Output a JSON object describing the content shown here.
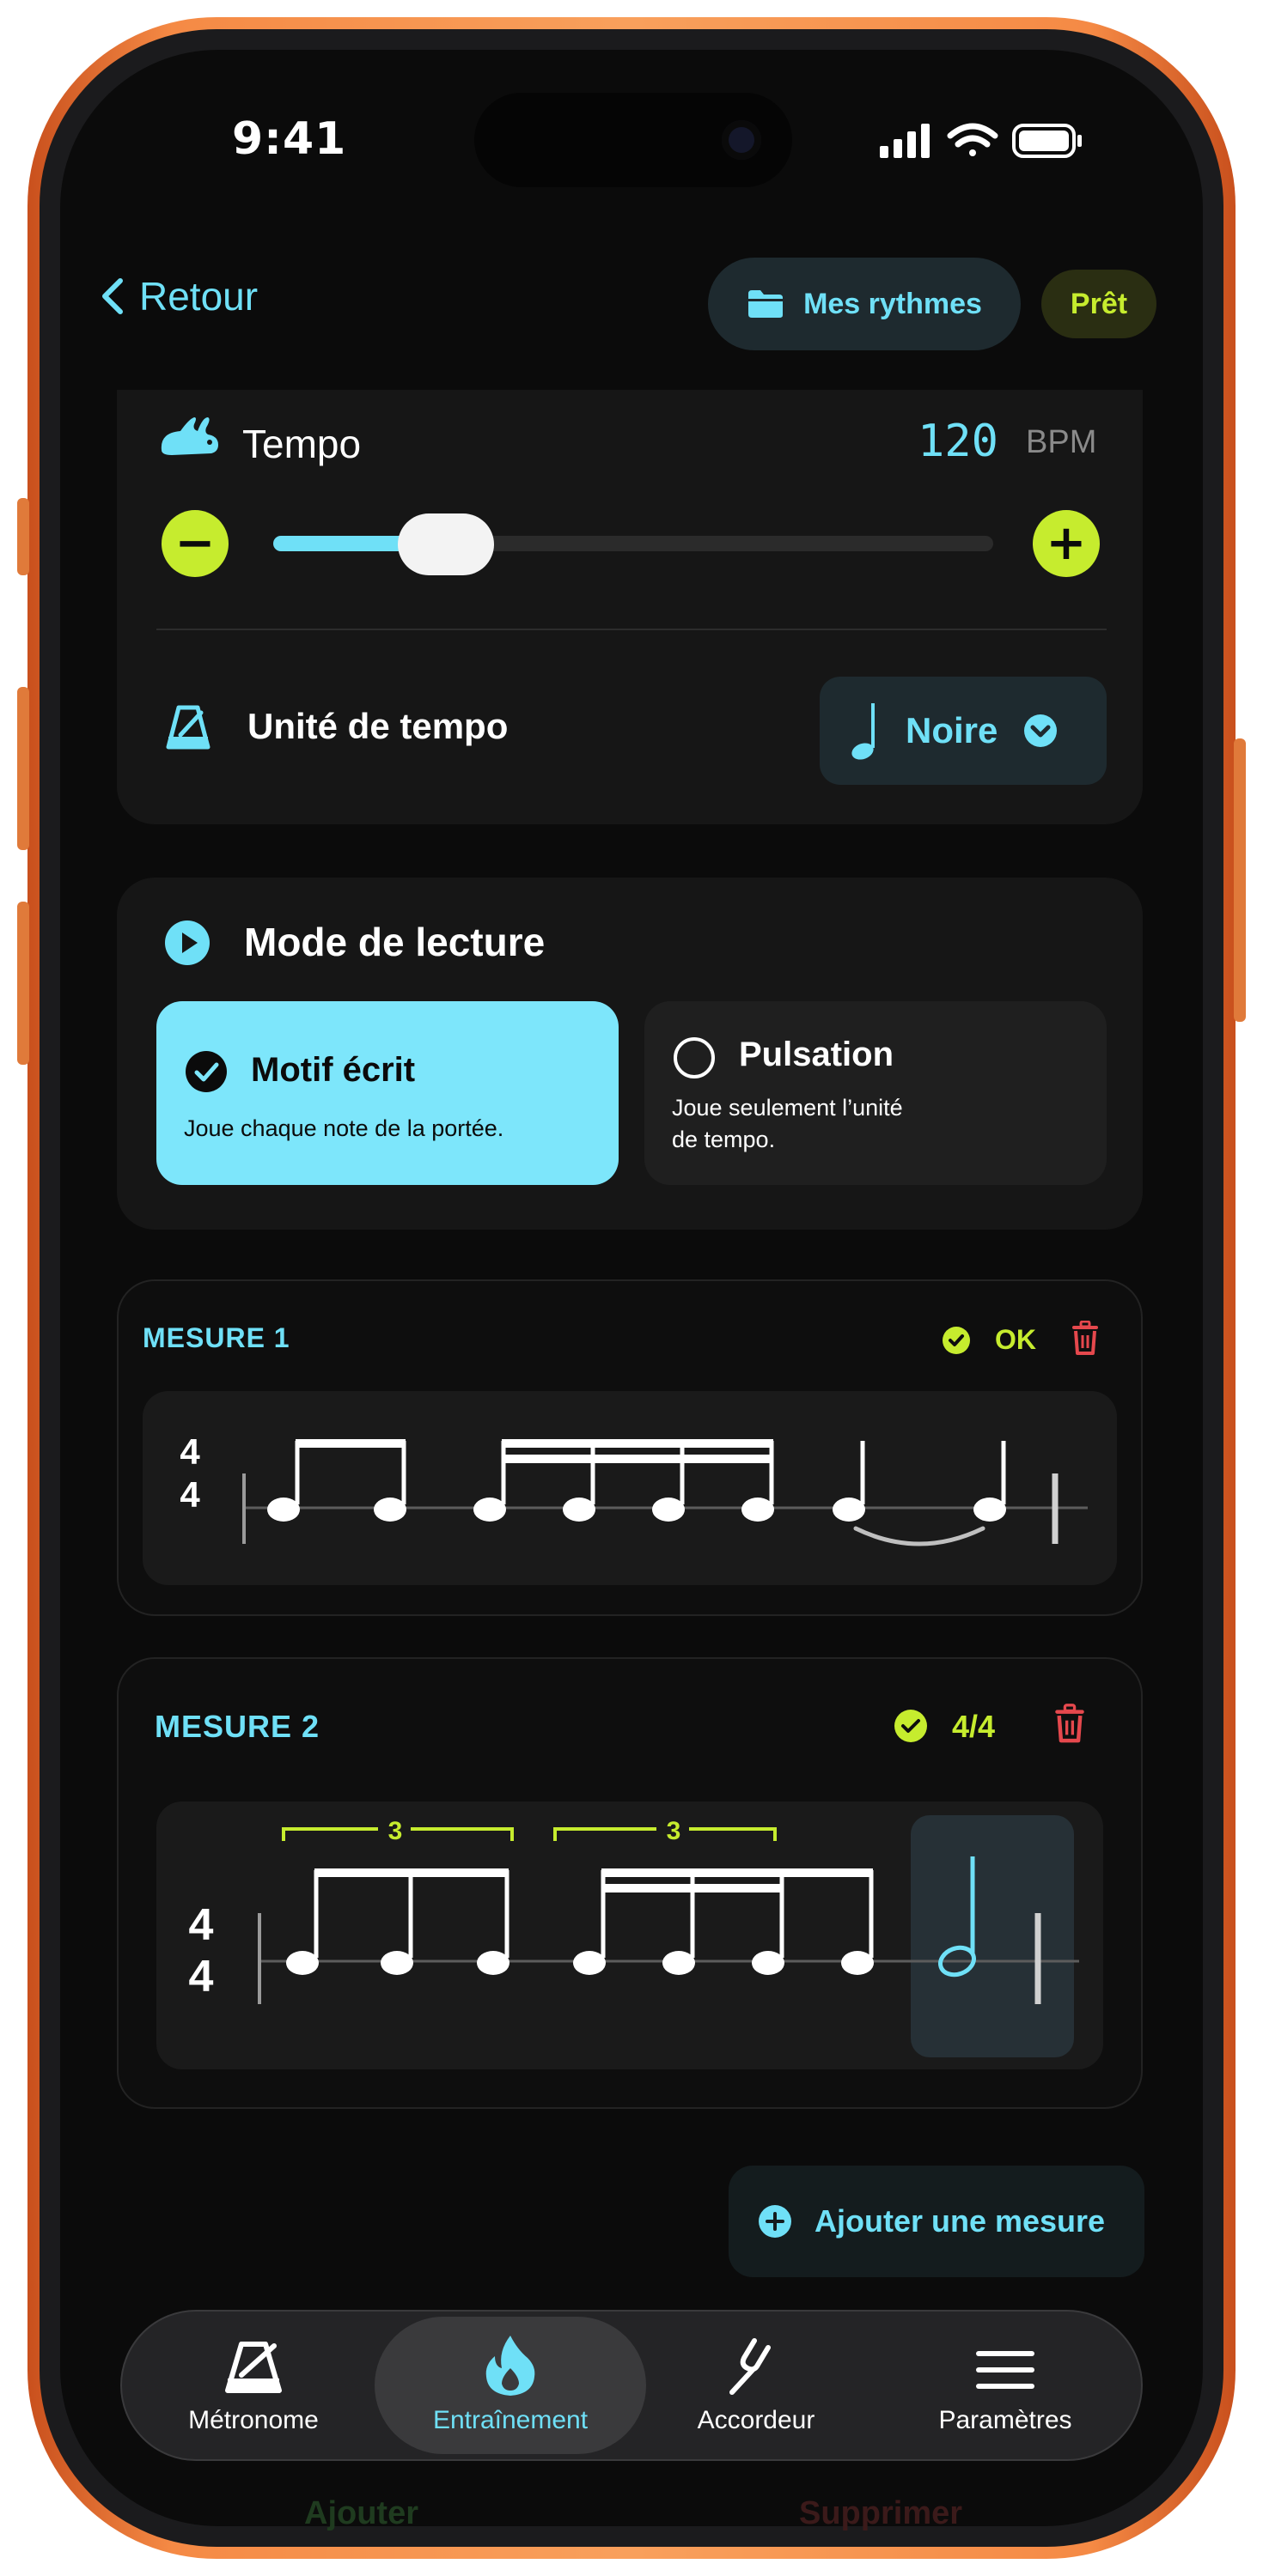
{
  "status_bar": {
    "time": "9:41"
  },
  "nav": {
    "back_label": "Retour",
    "rhythms_label": "Mes rythmes",
    "ready_badge": "Prêt"
  },
  "tempo": {
    "label": "Tempo",
    "value": "120",
    "unit": "BPM",
    "slider_fraction": 0.24,
    "minus": "−",
    "plus": "+"
  },
  "tempo_unit": {
    "label": "Unité de tempo",
    "selected": "Noire"
  },
  "play_mode": {
    "title": "Mode de lecture",
    "options": [
      {
        "title": "Motif écrit",
        "desc1": "Joue chaque note de la portée.",
        "desc2": "",
        "selected": true
      },
      {
        "title": "Pulsation",
        "desc1": "Joue seulement l’unité",
        "desc2": "de tempo.",
        "selected": false
      }
    ]
  },
  "measures": [
    {
      "title": "MESURE 1",
      "status": "OK",
      "time_sig_top": "4",
      "time_sig_bottom": "4"
    },
    {
      "title": "MESURE 2",
      "status": "4/4",
      "time_sig_top": "4",
      "time_sig_bottom": "4",
      "tuplet_label": "3"
    }
  ],
  "add_measure": "Ajouter une mesure",
  "background_ghost": {
    "left": "Ajouter",
    "right": "Supprimer"
  },
  "tabs": [
    {
      "label": "Métronome",
      "icon": "metronome-icon",
      "active": false
    },
    {
      "label": "Entraînement",
      "icon": "flame-icon",
      "active": true
    },
    {
      "label": "Accordeur",
      "icon": "tuning-fork-icon",
      "active": false
    },
    {
      "label": "Paramètres",
      "icon": "menu-icon",
      "active": false
    }
  ],
  "colors": {
    "accent": "#6fe0f7",
    "lime": "#c6ec2e",
    "danger": "#e5484d",
    "frame": "#f58a45"
  }
}
